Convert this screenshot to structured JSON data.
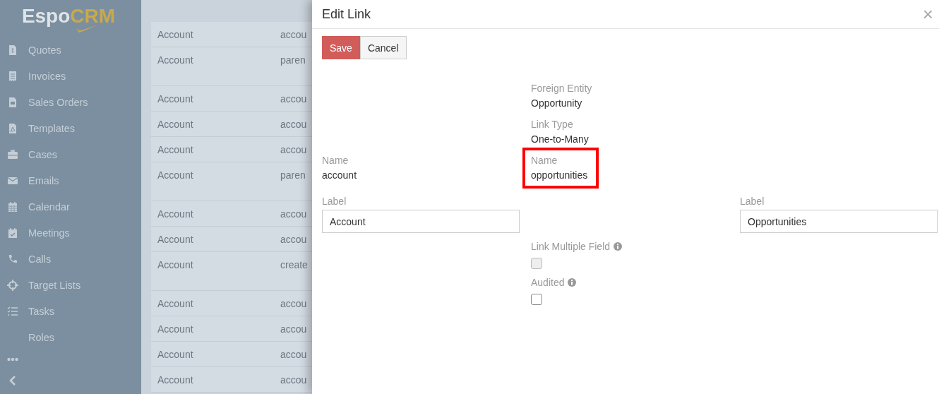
{
  "sidebar": {
    "logo": {
      "part_1": "Espo",
      "part_2": "CRM"
    },
    "items": [
      {
        "label": "Quotes"
      },
      {
        "label": "Invoices"
      },
      {
        "label": "Sales Orders"
      },
      {
        "label": "Templates"
      },
      {
        "label": "Cases"
      },
      {
        "label": "Emails"
      },
      {
        "label": "Calendar"
      },
      {
        "label": "Meetings"
      },
      {
        "label": "Calls"
      },
      {
        "label": "Target Lists"
      },
      {
        "label": "Tasks"
      },
      {
        "label": "Roles"
      }
    ]
  },
  "table": {
    "rows": [
      {
        "column_1": "Account",
        "column_2": "accou",
        "tall": false
      },
      {
        "column_1": "Account",
        "column_2": "paren",
        "tall": true
      },
      {
        "column_1": "Account",
        "column_2": "accou",
        "tall": false
      },
      {
        "column_1": "Account",
        "column_2": "accou",
        "tall": false
      },
      {
        "column_1": "Account",
        "column_2": "accou",
        "tall": false
      },
      {
        "column_1": "Account",
        "column_2": "paren",
        "tall": true
      },
      {
        "column_1": "Account",
        "column_2": "accou",
        "tall": false
      },
      {
        "column_1": "Account",
        "column_2": "accou",
        "tall": false
      },
      {
        "column_1": "Account",
        "column_2": "create",
        "tall": true
      },
      {
        "column_1": "Account",
        "column_2": "accou",
        "tall": false
      },
      {
        "column_1": "Account",
        "column_2": "accou",
        "tall": false
      },
      {
        "column_1": "Account",
        "column_2": "accou",
        "tall": false
      },
      {
        "column_1": "Account",
        "column_2": "accou",
        "tall": false
      }
    ]
  },
  "modal": {
    "title": "Edit Link",
    "close": "×",
    "buttons": [
      {
        "label": "Save",
        "kind": "primary"
      },
      {
        "label": "Cancel",
        "kind": "default"
      }
    ],
    "rows": [
      {
        "middle": {
          "kind": "static",
          "label": "Foreign Entity",
          "value": "Opportunity"
        }
      },
      {
        "middle": {
          "kind": "static",
          "label": "Link Type",
          "value": "One-to-Many"
        }
      },
      {
        "left": {
          "kind": "static",
          "label": "Name",
          "value": "account"
        },
        "middle": {
          "kind": "static",
          "label": "Name",
          "value": "opportunities",
          "highlighted": true
        }
      },
      {
        "left": {
          "kind": "input",
          "label": "Label",
          "value": "Account"
        },
        "right": {
          "kind": "input",
          "label": "Label",
          "value": "Opportunities"
        }
      },
      {
        "middle": {
          "kind": "checkbox",
          "label": "Link Multiple Field",
          "info": true,
          "checked": false,
          "disabled": true
        }
      },
      {
        "middle": {
          "kind": "checkbox",
          "label": "Audited",
          "info": true,
          "checked": false,
          "disabled": false
        }
      }
    ]
  }
}
